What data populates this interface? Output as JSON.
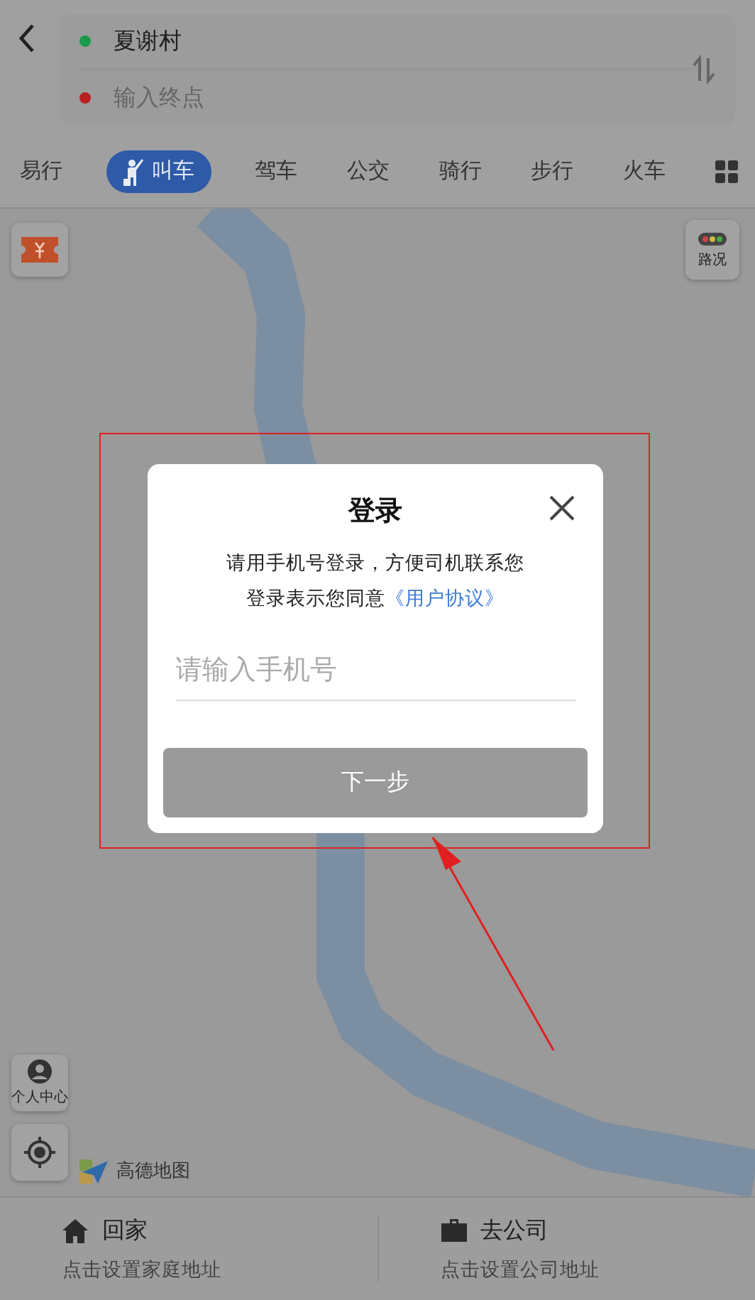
{
  "route": {
    "start": "夏谢村",
    "end": {
      "placeholder": "输入终点"
    }
  },
  "tabs": [
    {
      "label": "易行",
      "selected": false
    },
    {
      "label": "叫车",
      "selected": true
    },
    {
      "label": "驾车",
      "selected": false
    },
    {
      "label": "公交",
      "selected": false
    },
    {
      "label": "骑行",
      "selected": false
    },
    {
      "label": "步行",
      "selected": false
    },
    {
      "label": "火车",
      "selected": false
    }
  ],
  "map": {
    "traffic_label": "路况",
    "profile_label": "个人中心",
    "logo": "高德地图"
  },
  "dialog": {
    "title": "登录",
    "message": "请用手机号登录，方便司机联系您",
    "agreement": {
      "text": "登录表示您同意",
      "link": "《用户协议》"
    },
    "phone": {
      "placeholder": "请输入手机号"
    },
    "next": {
      "label": "下一步",
      "disabled": true
    }
  },
  "shortcuts": [
    {
      "kind": "home",
      "title": "回家",
      "subtitle": "点击设置家庭地址"
    },
    {
      "kind": "work",
      "title": "去公司",
      "subtitle": "点击设置公司地址"
    }
  ]
}
